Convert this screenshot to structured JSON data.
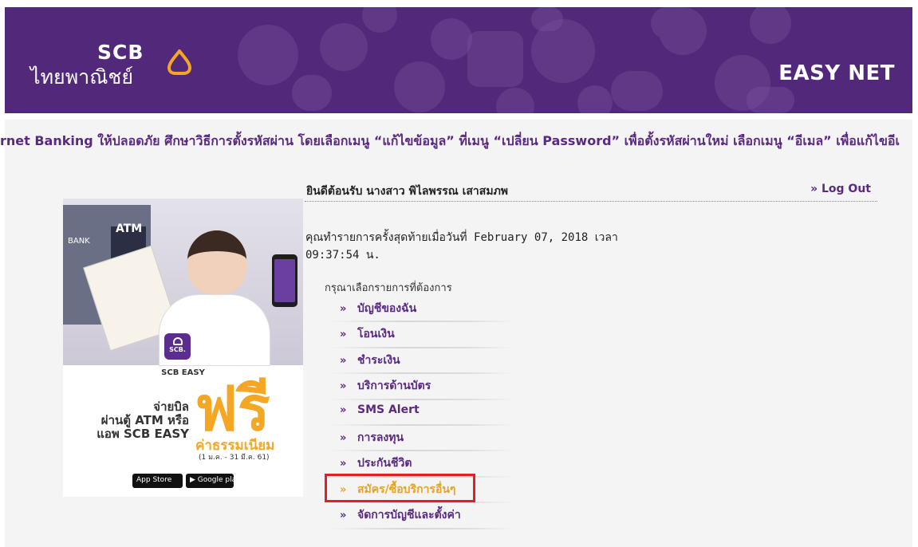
{
  "header": {
    "logo_text": "SCB",
    "logo_thai": "ไทยพาณิชย์",
    "product": "EASY NET",
    "brand_color": "#52297a"
  },
  "marquee": {
    "text": "rnet Banking ให้ปลอดภัย ศึกษาวิธีการตั้งรหัสผ่าน โดยเลือกเมนู “แก้ไขข้อมูล” ที่เมนู “เปลี่ยน Password” เพื่อตั้งรหัสผ่านใหม่ เลือกเมนู “อีเมล” เพื่อแก้ไขอีเ"
  },
  "welcome": {
    "greeting": "ยินดีต้อนรับ นางสาว พิไลพรรณ เสาสมภพ",
    "logout": "» Log Out"
  },
  "last_login": {
    "line1": "คุณทำรายการครั้งสุดท้ายเมื่อวันที่ February 07, 2018 เวลา",
    "line2": "09:37:54 น."
  },
  "ad": {
    "atm_label": "ATM",
    "bank_label": "BANK",
    "app_icon_text": "SCB.",
    "app_name": "SCB EASY",
    "pay_line1": "จ่ายบิล",
    "pay_line2": "ผ่านตู้ ATM หรือ",
    "pay_line3": "แอพ SCB EASY",
    "free": "ฟรี",
    "fee": "ค่าธรรมเนียม",
    "period": "(1 ม.ค. - 31 มี.ค. 61)",
    "appstore": "App Store",
    "googleplay": "Google play",
    "accent": "#f5a623"
  },
  "menu": {
    "title": "กรุณาเลือกรายการที่ต้องการ",
    "arrow": "»",
    "items": [
      {
        "label": "บัญชีของฉัน"
      },
      {
        "label": "โอนเงิน"
      },
      {
        "label": "ชำระเงิน"
      },
      {
        "label": "บริการด้านบัตร"
      },
      {
        "label": "SMS Alert"
      },
      {
        "label": "การลงทุน"
      },
      {
        "label": "ประกันชีวิต"
      },
      {
        "label": "สมัคร/ซื้อบริการอื่นๆ"
      },
      {
        "label": "จัดการบัญชีและตั้งค่า"
      }
    ],
    "highlight_color": "#e8a321",
    "box_color": "#e41e26"
  }
}
